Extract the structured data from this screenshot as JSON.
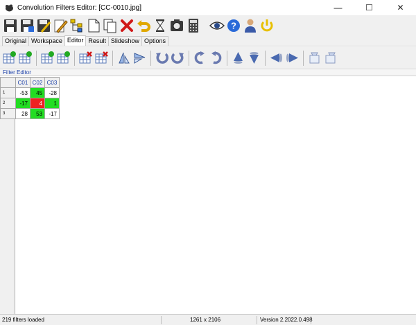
{
  "window": {
    "title": "Convolution Filters Editor: [CC-0010.jpg]",
    "icon": "app-icon",
    "controls": {
      "minimize": "—",
      "maximize": "☐",
      "close": "✕"
    }
  },
  "toolbar_main": [
    {
      "name": "save-icon"
    },
    {
      "name": "save-as-icon"
    },
    {
      "name": "save-all-icon"
    },
    {
      "name": "edit-pencil-icon"
    },
    {
      "name": "hierarchy-icon"
    },
    {
      "name": "new-page-icon"
    },
    {
      "name": "copy-pages-icon"
    },
    {
      "name": "delete-x-icon"
    },
    {
      "name": "undo-icon"
    },
    {
      "name": "hourglass-icon"
    },
    {
      "name": "screenshot-icon"
    },
    {
      "name": "calculator-icon"
    },
    {
      "name": "eye-icon"
    },
    {
      "name": "help-icon"
    },
    {
      "name": "user-icon"
    },
    {
      "name": "power-icon"
    }
  ],
  "tabs": [
    {
      "label": "Original",
      "active": false
    },
    {
      "label": "Workspace",
      "active": false
    },
    {
      "label": "Editor",
      "active": true
    },
    {
      "label": "Result",
      "active": false
    },
    {
      "label": "Slideshow",
      "active": false
    },
    {
      "label": "Options",
      "active": false
    }
  ],
  "toolbar_editor": [
    {
      "name": "insert-column-icon"
    },
    {
      "name": "append-column-icon"
    },
    {
      "sep": true
    },
    {
      "name": "insert-row-icon"
    },
    {
      "name": "append-row-icon"
    },
    {
      "sep": true
    },
    {
      "name": "delete-column-icon"
    },
    {
      "name": "delete-row-icon"
    },
    {
      "sep": true
    },
    {
      "name": "flip-vertical-icon"
    },
    {
      "name": "flip-horizontal-icon"
    },
    {
      "sep": true
    },
    {
      "name": "rotate-left-icon"
    },
    {
      "name": "rotate-right-icon"
    },
    {
      "sep": true
    },
    {
      "name": "rotate-ccw-icon"
    },
    {
      "name": "rotate-cw-icon"
    },
    {
      "sep": true
    },
    {
      "name": "move-up-icon"
    },
    {
      "name": "move-down-icon"
    },
    {
      "sep": true
    },
    {
      "name": "move-left-icon"
    },
    {
      "name": "move-right-icon"
    },
    {
      "sep": true
    },
    {
      "name": "import-icon"
    },
    {
      "name": "export-icon"
    }
  ],
  "panel": {
    "title": "Filter Editor"
  },
  "grid": {
    "columns": [
      "C01",
      "C02",
      "C03"
    ],
    "rows": [
      {
        "header": "1",
        "cells": [
          {
            "value": "-53",
            "color": "#ffffff"
          },
          {
            "value": "45",
            "color": "#22dd22"
          },
          {
            "value": "-28",
            "color": "#ffffff"
          }
        ]
      },
      {
        "header": "2",
        "cells": [
          {
            "value": "-17",
            "color": "#22dd22"
          },
          {
            "value": "4",
            "color": "#ee2222",
            "text_color": "#ffffff"
          },
          {
            "value": "1",
            "color": "#22dd22"
          }
        ]
      },
      {
        "header": "3",
        "cells": [
          {
            "value": "28",
            "color": "#ffffff"
          },
          {
            "value": "53",
            "color": "#22dd22"
          },
          {
            "value": "-17",
            "color": "#ffffff"
          }
        ]
      }
    ]
  },
  "status": {
    "filters": "219 filters loaded",
    "dimensions": "1261 x 2106",
    "version": "Version 2.2022.0.498"
  }
}
